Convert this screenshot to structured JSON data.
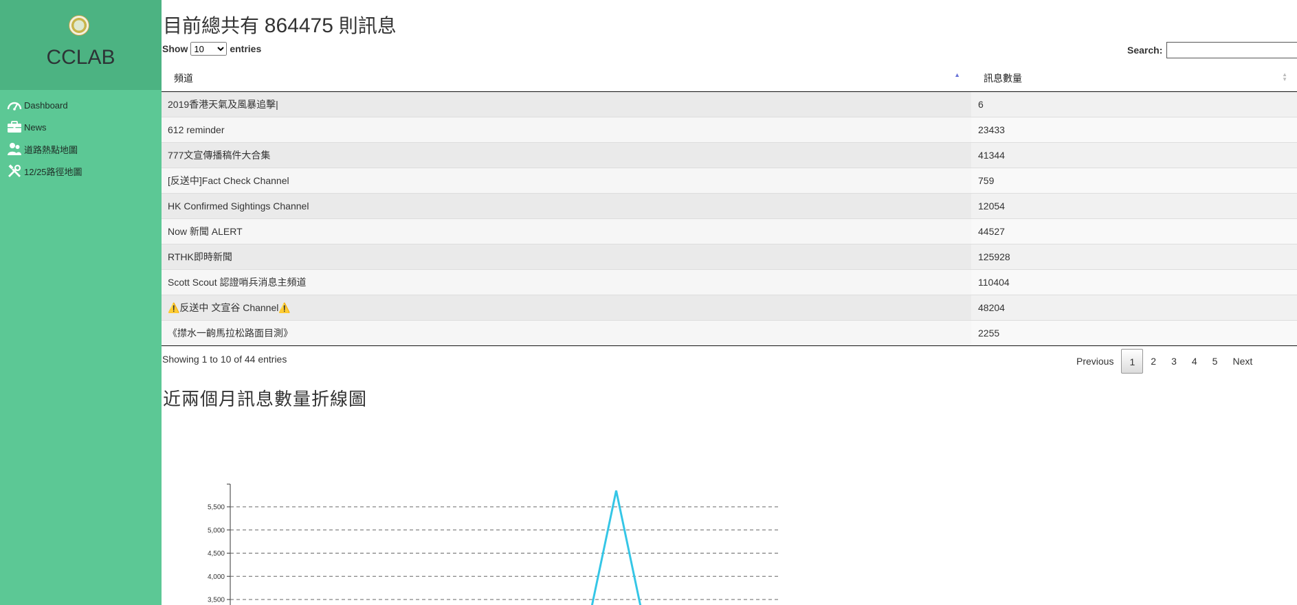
{
  "brand": {
    "name": "CCLAB",
    "logo_icon": "lab-seal-logo"
  },
  "sidebar": {
    "items": [
      {
        "label": "Dashboard",
        "icon": "gauge-icon"
      },
      {
        "label": "News",
        "icon": "briefcase-icon"
      },
      {
        "label": "道路熱點地圖",
        "icon": "users-icon"
      },
      {
        "label": "12/25路徑地圖",
        "icon": "tools-icon"
      }
    ]
  },
  "header": {
    "prefix": "目前總共有",
    "count": "864475",
    "suffix": "則訊息"
  },
  "length": {
    "show": "Show",
    "value": "10",
    "entries": "entries"
  },
  "search": {
    "label": "Search:",
    "value": ""
  },
  "table": {
    "columns": [
      "頻道",
      "訊息數量"
    ],
    "rows": [
      {
        "channel": "2019香港天氣及風暴追擊|",
        "count": "6"
      },
      {
        "channel": "612 reminder",
        "count": "23433"
      },
      {
        "channel": "777文宣傳播稿件大合集",
        "count": "41344"
      },
      {
        "channel": "[反送中]Fact Check Channel",
        "count": "759"
      },
      {
        "channel": "HK Confirmed Sightings Channel",
        "count": "12054"
      },
      {
        "channel": "Now 新聞 ALERT",
        "count": "44527"
      },
      {
        "channel": "RTHK即時新聞",
        "count": "125928"
      },
      {
        "channel": "Scott Scout 認證哨兵消息主頻道",
        "count": "110404"
      },
      {
        "channel": "⚠️反送中 文宣谷 Channel⚠️",
        "count": "48204"
      },
      {
        "channel": "《㩒水一齣馬拉松路面目測》",
        "count": "2255"
      }
    ]
  },
  "info": "Showing 1 to 10 of 44 entries",
  "pagination": {
    "previous": "Previous",
    "pages": [
      "1",
      "2",
      "3",
      "4",
      "5"
    ],
    "current": "1",
    "next": "Next"
  },
  "chart_title": "近兩個月訊息數量折線圖",
  "chart_data": {
    "type": "line",
    "title": "",
    "xlabel": "",
    "ylabel": "",
    "ylim": [
      3000,
      5800
    ],
    "yticks": [
      "3,500",
      "4,000",
      "4,500",
      "5,000",
      "5,500"
    ],
    "grid": "horizontal dashed",
    "series_color": "#35c6e6",
    "series": [
      {
        "points": [
          [
            0.69,
            3000
          ],
          [
            0.735,
            5850
          ],
          [
            0.78,
            3000
          ]
        ]
      }
    ]
  }
}
